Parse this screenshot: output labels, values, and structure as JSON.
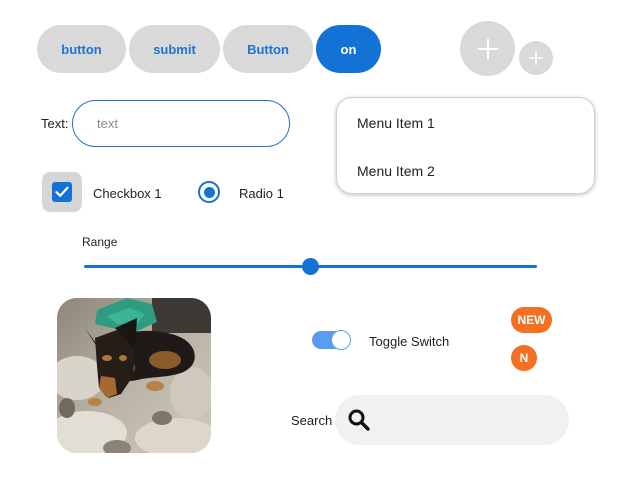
{
  "buttons": [
    {
      "label": "button"
    },
    {
      "label": "submit"
    },
    {
      "label": "Button"
    },
    {
      "label": "on"
    }
  ],
  "fabs": [
    {
      "icon": "plus-icon",
      "size": "large"
    },
    {
      "icon": "plus-icon",
      "size": "small"
    }
  ],
  "text_field": {
    "label": "Text:",
    "placeholder": "text",
    "value": ""
  },
  "menu": {
    "items": [
      {
        "label": "Menu Item 1"
      },
      {
        "label": "Menu Item 2"
      }
    ]
  },
  "checkbox": {
    "label": "Checkbox 1",
    "checked": true
  },
  "radio": {
    "label": "Radio 1",
    "selected": true
  },
  "range": {
    "label": "Range",
    "value": 0.5
  },
  "image": {
    "icon": "dog-photo"
  },
  "toggle": {
    "label": "Toggle Switch",
    "on": true
  },
  "badges": [
    {
      "label": "NEW"
    },
    {
      "label": "N"
    }
  ],
  "search": {
    "label": "Search",
    "value": "",
    "icon": "search-icon"
  },
  "colors": {
    "accent": "#1372d6",
    "pill_bg": "#d9d9d9",
    "badge": "#f37021",
    "toggle": "#5c9cf0"
  }
}
